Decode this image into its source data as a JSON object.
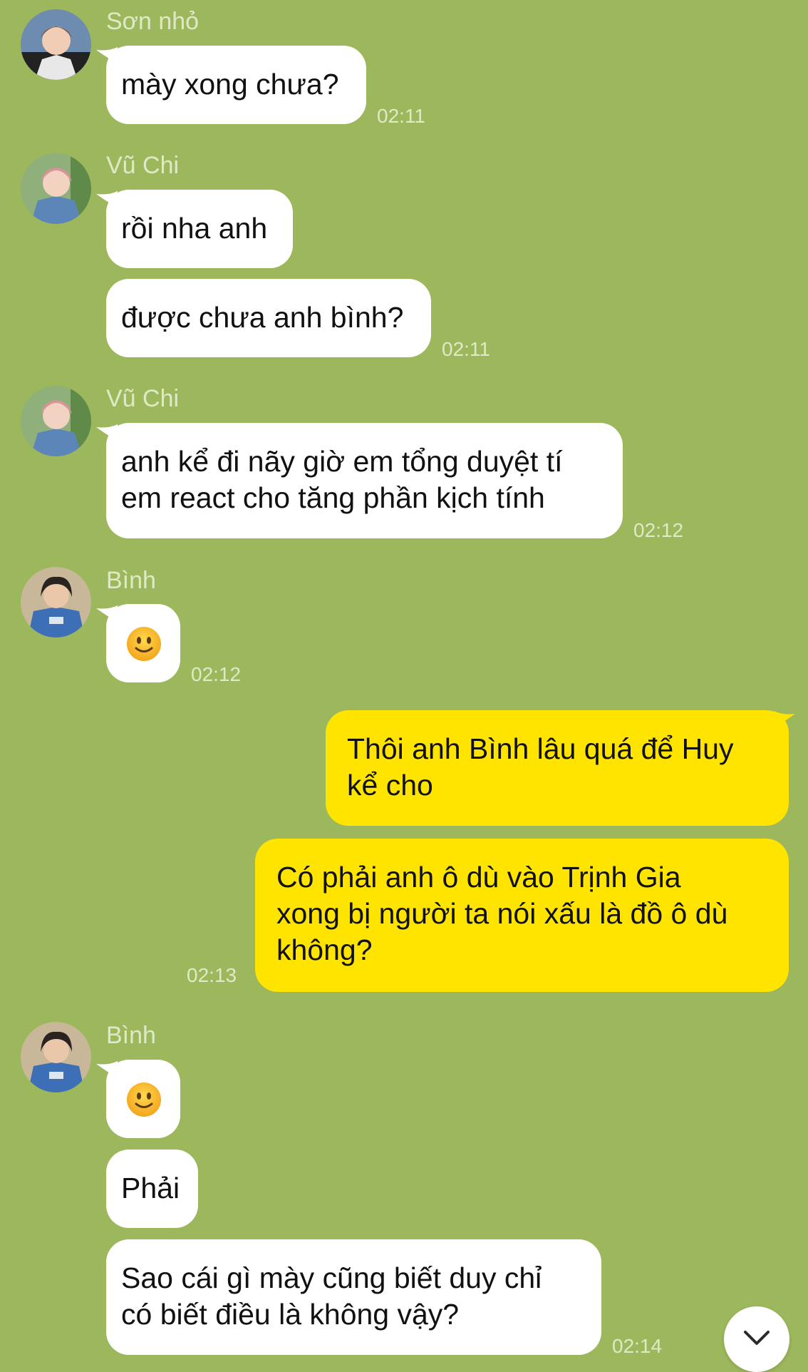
{
  "chat": {
    "groups": [
      {
        "sender": "Sơn nhỏ",
        "messages": [
          {
            "text": "mày xong chưa?",
            "time": "02:11"
          }
        ]
      },
      {
        "sender": "Vũ Chi",
        "messages": [
          {
            "text": "rồi nha anh"
          },
          {
            "text": "được chưa anh bình?",
            "time": "02:11"
          }
        ]
      },
      {
        "sender": "Vũ Chi",
        "messages": [
          {
            "lines": [
              "anh kể đi nãy giờ em tổng duyệt tí",
              "em react cho tăng phần kịch tính"
            ],
            "time": "02:12"
          }
        ]
      },
      {
        "sender": "Bình",
        "messages": [
          {
            "emoji": "slightly-smiling-face-emoji",
            "time": "02:12"
          }
        ]
      },
      {
        "sender": "me",
        "messages": [
          {
            "lines": [
              "Thôi anh Bình lâu quá để Huy",
              "kể cho"
            ]
          },
          {
            "lines": [
              "Có phải anh ô dù vào Trịnh Gia",
              "xong bị người ta nói xấu là đồ ô dù",
              "không?"
            ],
            "time": "02:13"
          }
        ]
      },
      {
        "sender": "Bình",
        "messages": [
          {
            "emoji": "slightly-smiling-face-emoji"
          },
          {
            "text": "Phải"
          },
          {
            "lines": [
              "Sao cái gì mày cũng biết duy chỉ",
              "có biết điều là không vậy?"
            ],
            "time": "02:14"
          }
        ]
      }
    ]
  },
  "colors": {
    "background": "#9db85c",
    "incoming_bubble": "#ffffff",
    "outgoing_bubble": "#ffe400",
    "meta_text": "#dfe9c6",
    "message_text": "#111111"
  },
  "icons": {
    "scroll_down": "chevron-down-icon"
  }
}
